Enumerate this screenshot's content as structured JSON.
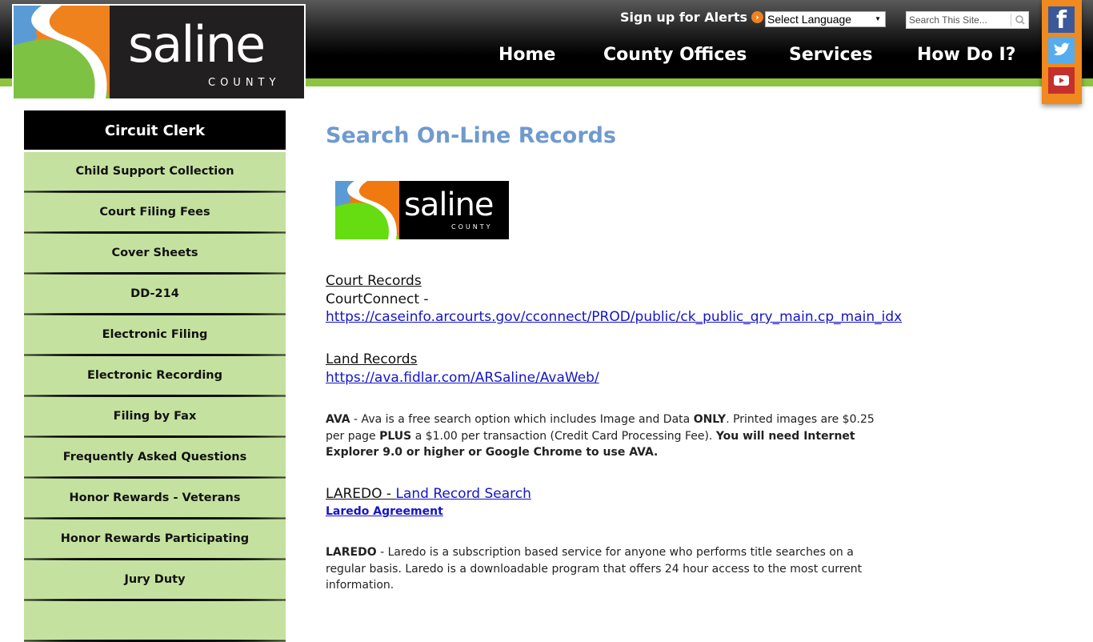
{
  "header": {
    "logo_word": "saline",
    "logo_county": "COUNTY",
    "alerts_label": "Sign up for Alerts",
    "language_select": "Select Language",
    "search_placeholder": "Search This Site...",
    "nav": [
      "Home",
      "County Offices",
      "Services",
      "How Do I?"
    ],
    "social": [
      "facebook",
      "twitter",
      "youtube"
    ]
  },
  "sidebar": {
    "title": "Circuit Clerk",
    "items": [
      "Child Support Collection",
      "Court Filing Fees",
      "Cover Sheets",
      "DD-214",
      "Electronic Filing",
      "Electronic Recording",
      "Filing by Fax",
      "Frequently Asked Questions",
      "Honor Rewards - Veterans",
      "Honor Rewards Participating Businesses",
      "Jury Duty"
    ]
  },
  "main": {
    "title": "Search On-Line Records",
    "logo_word": "saline",
    "logo_county": "COUNTY",
    "court_heading": "Court Records",
    "court_label": "CourtConnect -",
    "court_url": "https://caseinfo.arcourts.gov/cconnect/PROD/public/ck_public_qry_main.cp_main_idx",
    "land_heading": "Land Records",
    "land_url": "https://ava.fidlar.com/ARSaline/AvaWeb/",
    "ava": {
      "b1": "AVA",
      "t1": " - Ava is a free search option which includes Image and Data ",
      "b2": "ONLY",
      "t2": ". Printed images are $0.25 per page ",
      "b3": "PLUS",
      "t3": " a $1.00 per transaction (Credit Card Processing Fee). ",
      "b4": "You will need Internet Explorer 9.0 or higher or Google Chrome to use AVA."
    },
    "laredo_prefix": "LAREDO - ",
    "laredo_link": "Land Record Search",
    "laredo_agreement": "Laredo Agreement",
    "laredo_desc_bold": "LAREDO",
    "laredo_desc": " - Laredo is a subscription based service for anyone who performs title searches on a regular basis. Laredo is a downloadable program that offers 24 hour access to the most current information."
  }
}
